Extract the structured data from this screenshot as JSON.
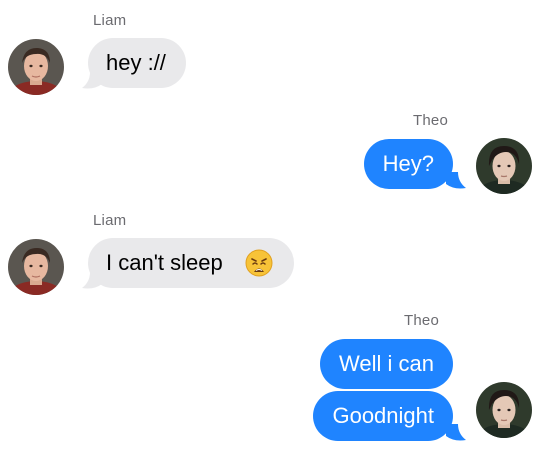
{
  "conversation": {
    "messages": [
      {
        "sender": "Liam",
        "direction": "incoming",
        "text": "hey ://"
      },
      {
        "sender": "Theo",
        "direction": "outgoing",
        "text": "Hey?"
      },
      {
        "sender": "Liam",
        "direction": "incoming",
        "text": "I can't sleep",
        "emoji": "weary-face-emoji"
      },
      {
        "sender": "Theo",
        "direction": "outgoing",
        "text": "Well i can"
      },
      {
        "sender": "Theo",
        "direction": "outgoing",
        "text": "Goodnight"
      }
    ]
  },
  "colors": {
    "outgoing_bubble": "#1f84ff",
    "incoming_bubble": "#e9e9eb",
    "sender_name": "#6b6b70"
  }
}
